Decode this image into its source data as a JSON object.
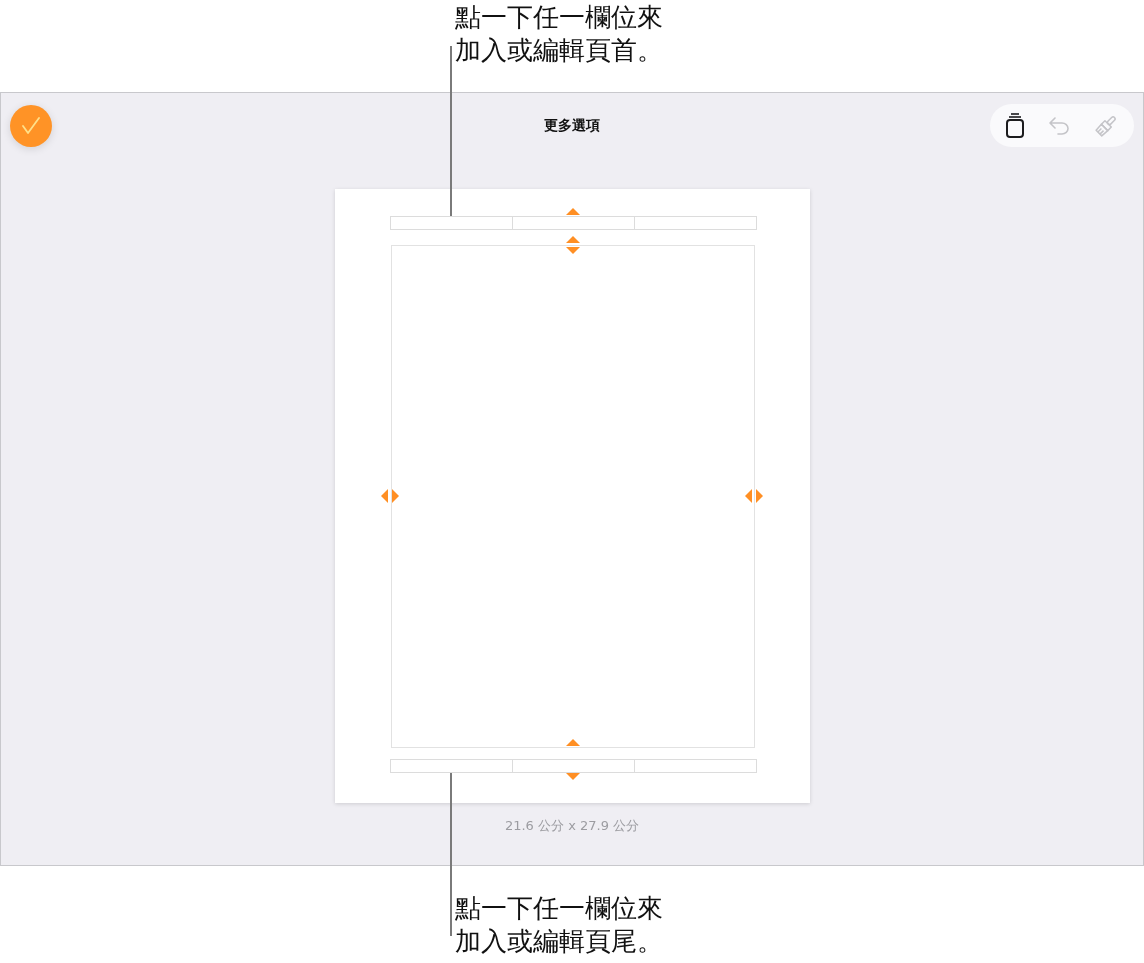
{
  "header_callout": {
    "text": "點一下任一欄位來加入或編輯頁首。"
  },
  "screen": {
    "title": "更多選項"
  },
  "toolbar": {
    "buttons": [
      {
        "kind": "pages",
        "disabled": false
      },
      {
        "kind": "undo",
        "disabled": true
      },
      {
        "kind": "brush",
        "disabled": true
      }
    ]
  },
  "page": {
    "size_label": "21.6 公分 x 27.9 公分"
  },
  "footer_callout": {
    "text": "點一下任一欄位來加入或編輯頁尾。"
  }
}
